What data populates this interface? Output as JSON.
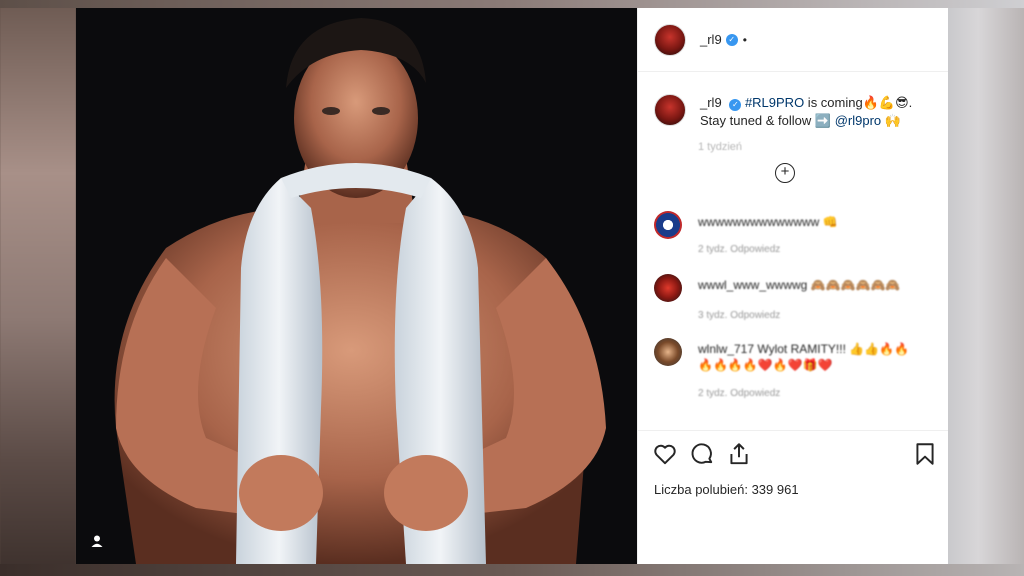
{
  "post": {
    "username": "_rl9",
    "header_dot": "•",
    "caption": {
      "username": "_rl9",
      "hashtag": "#RL9PRO",
      "text_after_hashtag": " is coming🔥💪😎.",
      "line2_prefix": "Stay tuned & follow ",
      "arrow": "➡️",
      "mention": "@rl9pro",
      "line2_suffix": " 🙌"
    },
    "caption_time": "1 tydzień",
    "load_more_symbol": "+"
  },
  "comments": [
    {
      "text": "wwwwwwwwwwwwww 👊",
      "meta": "2 tydz.   Odpowiedz",
      "line2": ""
    },
    {
      "text": "wwwl_www_wwwwg 🙈🙈🙈🙈🙈🙈",
      "meta": "3 tydz.   Odpowiedz",
      "line2": ""
    },
    {
      "text": "wlnlw_717 Wylot RAMITY!!! 👍👍🔥🔥",
      "line2": "🔥🔥🔥🔥❤️🔥❤️🎁❤️",
      "meta": "2 tydz.   Odpowiedz"
    }
  ],
  "actions": {
    "likes_label": "Liczba polubień: 339 961"
  },
  "icons": {
    "like": "heart-icon",
    "comment": "comment-icon",
    "share": "share-icon",
    "save": "bookmark-icon",
    "user_tag": "user-tag-icon",
    "verified": "verified-badge-icon"
  },
  "colors": {
    "verified": "#3897f0",
    "link": "#00376b",
    "text": "#262626",
    "muted": "#999999"
  }
}
